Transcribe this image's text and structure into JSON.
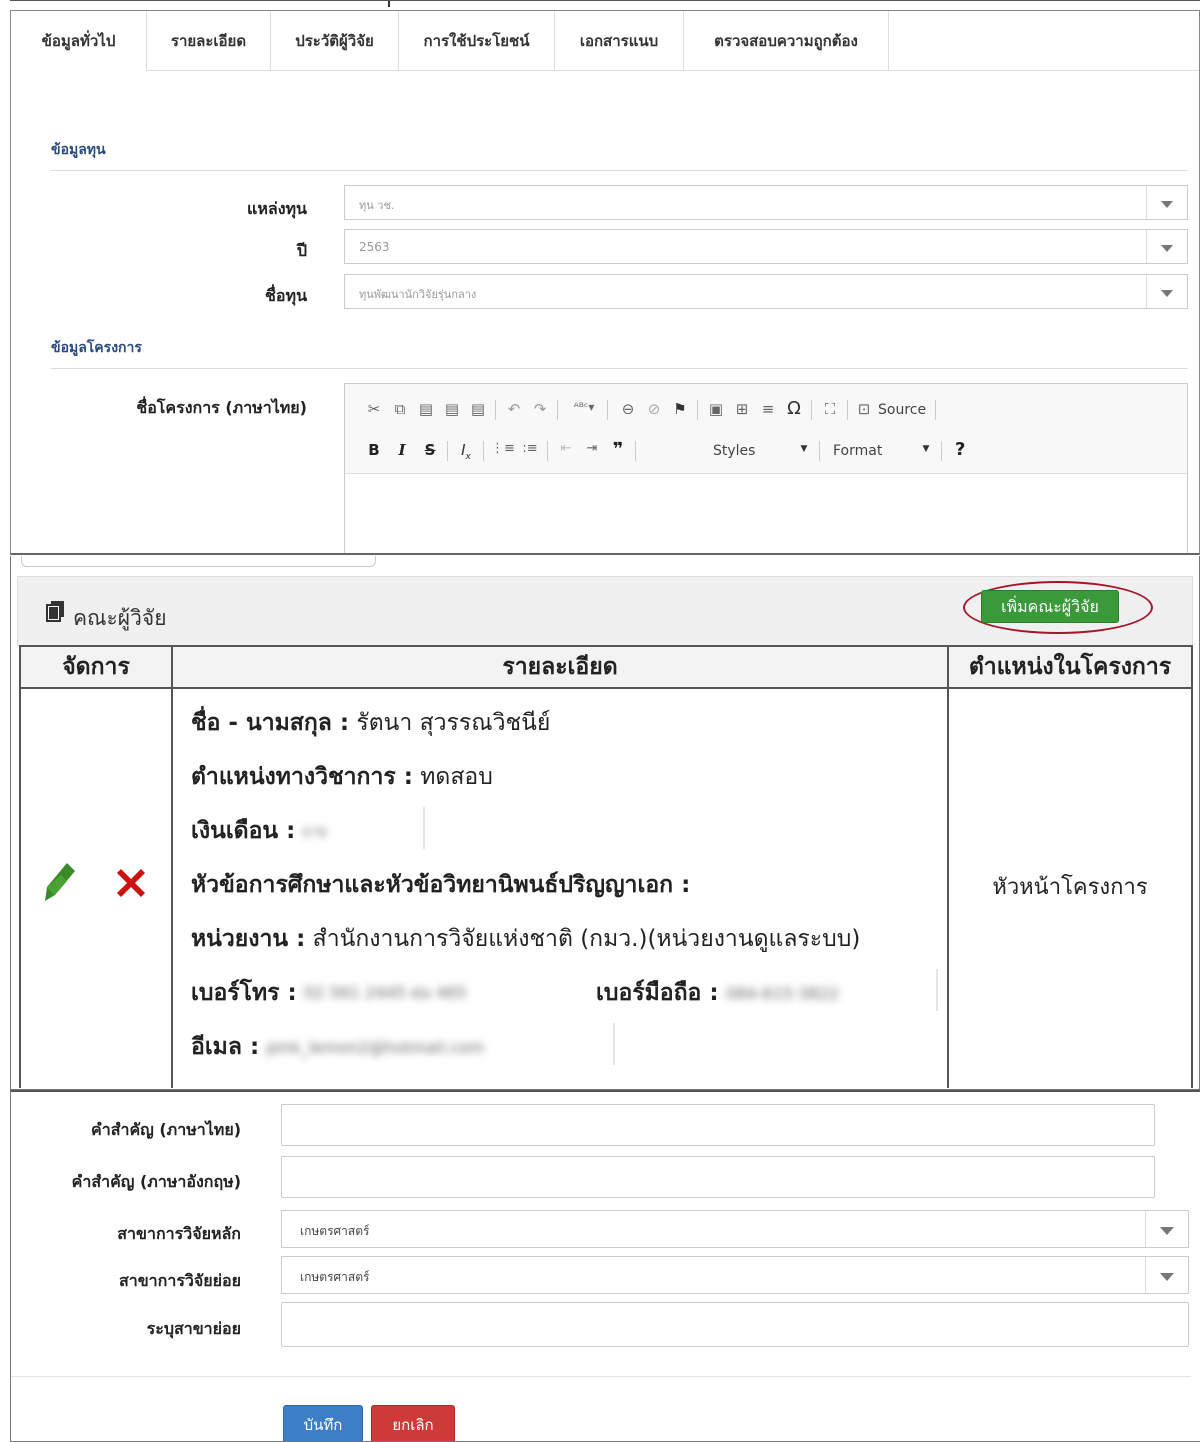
{
  "tabs": [
    "ข้อมูลทั่วไป",
    "รายละเอียด",
    "ประวัติผู้วิจัย",
    "การใช้ประโยชน์",
    "เอกสารแนบ",
    "ตรวจสอบความถูกต้อง"
  ],
  "fund_section": {
    "heading": "ข้อมูลทุน",
    "source_label": "แหล่งทุน",
    "source_value": "ทุน วช.",
    "year_label": "ปี",
    "year_value": "2563",
    "fund_name_label": "ชื่อทุน",
    "fund_name_value": "ทุนพัฒนานักวิจัยรุ่นกลาง"
  },
  "project_section": {
    "heading": "ข้อมูลโครงการ",
    "project_name_th_label": "ชื่อโครงการ (ภาษาไทย)"
  },
  "editor": {
    "source_label": "Source",
    "styles_label": "Styles",
    "format_label": "Format",
    "help_label": "?"
  },
  "team": {
    "title": "คณะผู้วิจัย",
    "add_button": "เพิ่มคณะผู้วิจัย",
    "col_manage": "จัดการ",
    "col_detail": "รายละเอียด",
    "col_position": "ตำแหน่งในโครงการ",
    "name_label": "ชื่อ - นามสกุล :",
    "name_value": "รัตนา สุวรรณวิชนีย์",
    "academic_label": "ตำแหน่งทางวิชาการ :",
    "academic_value": "ทดสอบ",
    "salary_label": "เงินเดือน :",
    "salary_value": "ยาย",
    "thesis_label": "หัวข้อการศึกษาและหัวข้อวิทยานิพนธ์ปริญญาเอก :",
    "unit_label": "หน่วยงาน :",
    "unit_value": "สำนักงานการวิจัยแห่งชาติ (กมว.)(หน่วยงานดูแลระบบ)",
    "phone_label": "เบอร์โทร :",
    "phone_value": "02 561 2445 ต่อ 465",
    "mobile_label": "เบอร์มือถือ :",
    "mobile_value": "084-615-3822",
    "email_label": "อีเมล :",
    "email_value": "pink_lemon2@hotmail.com",
    "position_value": "หัวหน้าโครงการ"
  },
  "keywords": {
    "kw_th_label": "คำสำคัญ (ภาษาไทย)",
    "kw_en_label": "คำสำคัญ (ภาษาอังกฤษ)",
    "main_branch_label": "สาขาการวิจัยหลัก",
    "main_branch_value": "เกษตรศาสตร์",
    "sub_branch_label": "สาขาการวิจัยย่อย",
    "sub_branch_value": "เกษตรศาสตร์",
    "specify_sub_label": "ระบุสาขาย่อย"
  },
  "actions": {
    "save": "บันทึก",
    "cancel": "ยกเลิก"
  },
  "colors": {
    "add_button": "#3a9a3a",
    "oval": "#a2182a",
    "save_button": "#3d7fc4",
    "cancel_button": "#cc3a3a",
    "edit_icon": "#3a8a2a",
    "delete_icon": "#cc1111"
  }
}
